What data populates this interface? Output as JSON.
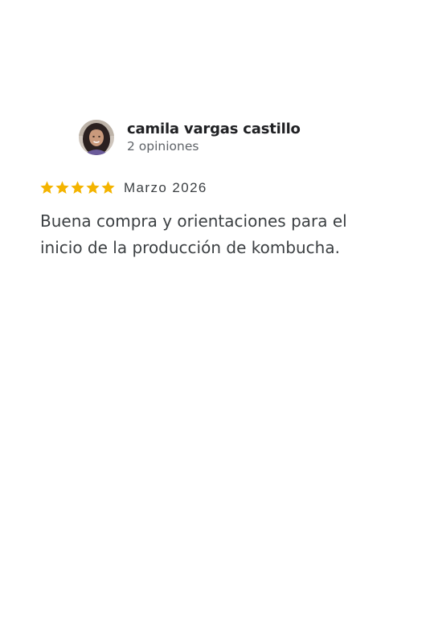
{
  "review": {
    "reviewer": {
      "name": "camila vargas castillo",
      "review_count": "2 opiniones",
      "avatar": "profile-photo"
    },
    "rating": {
      "stars": 5,
      "max_stars": 5,
      "star_color": "#f4b400",
      "star_icon": "star-icon"
    },
    "date": "Marzo 2026",
    "text": "Buena compra y orientaciones para el inicio de la producción de kombucha."
  }
}
